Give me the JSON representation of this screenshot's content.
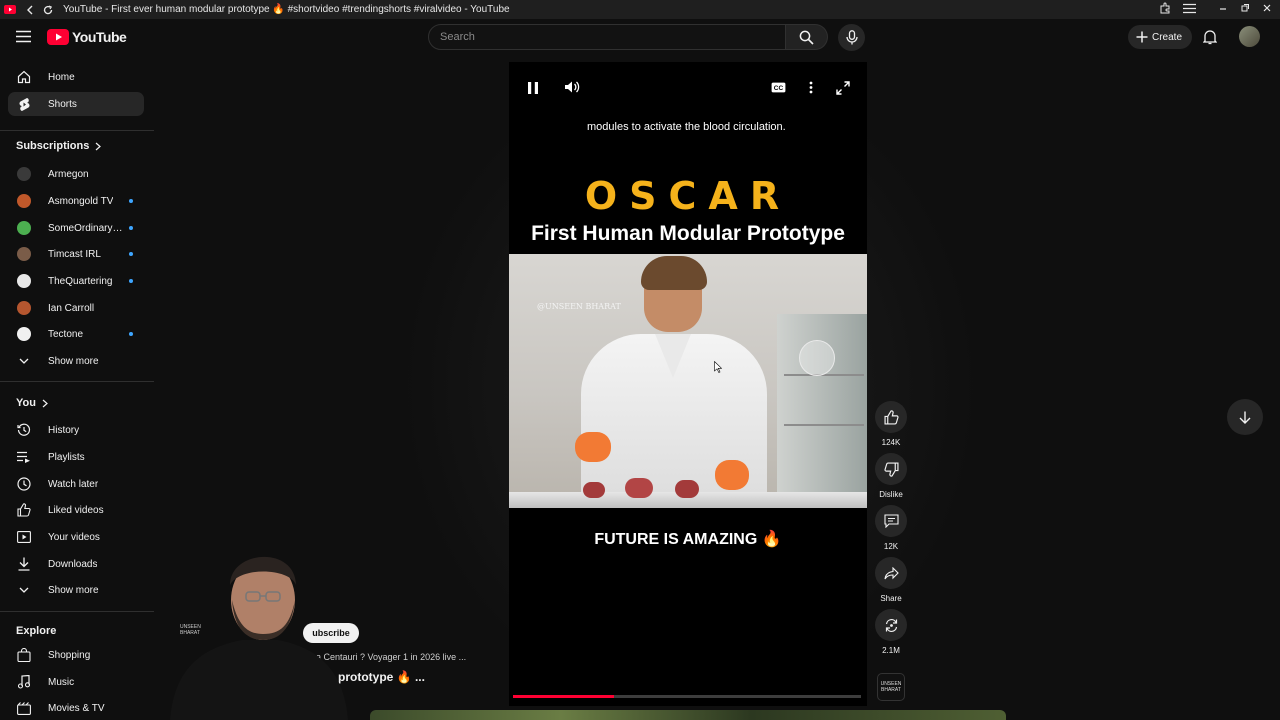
{
  "window": {
    "title": "YouTube - First ever human modular prototype 🔥 #shortvideo #trendingshorts #viralvideo - YouTube"
  },
  "masthead": {
    "logo_text": "YouTube",
    "search_placeholder": "Search",
    "create_label": "Create"
  },
  "sidebar": {
    "main": [
      {
        "label": "Home",
        "icon": "home-icon"
      },
      {
        "label": "Shorts",
        "icon": "shorts-icon",
        "active": true
      }
    ],
    "subscriptions_title": "Subscriptions",
    "subscriptions": [
      {
        "label": "Armegon",
        "color": "#5a4a3a",
        "dot": false
      },
      {
        "label": "Asmongold TV",
        "color": "#c0582a",
        "dot": true
      },
      {
        "label": "SomeOrdinaryGa...",
        "color": "#4caf50",
        "dot": true
      },
      {
        "label": "Timcast IRL",
        "color": "#7a5c48",
        "dot": true
      },
      {
        "label": "TheQuartering",
        "color": "#e8e8e8",
        "dot": true
      },
      {
        "label": "Ian Carroll",
        "color": "#b5562f",
        "dot": false
      },
      {
        "label": "Tectone",
        "color": "#f0f0f0",
        "dot": true
      }
    ],
    "show_more_1": "Show more",
    "you_title": "You",
    "you": [
      {
        "label": "History",
        "icon": "history-icon"
      },
      {
        "label": "Playlists",
        "icon": "playlists-icon"
      },
      {
        "label": "Watch later",
        "icon": "watch-later-icon"
      },
      {
        "label": "Liked videos",
        "icon": "liked-videos-icon"
      },
      {
        "label": "Your videos",
        "icon": "your-videos-icon"
      },
      {
        "label": "Downloads",
        "icon": "downloads-icon"
      }
    ],
    "show_more_2": "Show more",
    "explore_title": "Explore",
    "explore": [
      {
        "label": "Shopping",
        "icon": "shopping-icon"
      },
      {
        "label": "Music",
        "icon": "music-icon"
      },
      {
        "label": "Movies & TV",
        "icon": "movies-icon"
      }
    ]
  },
  "player": {
    "caption": "modules to activate the blood circulation.",
    "headline": "OSCAR",
    "subheadline": "First Human Modular Prototype",
    "watermark": "@UNSEEN BHARAT",
    "bottom_text": "FUTURE IS AMAZING 🔥",
    "progress": 0.29
  },
  "actions": {
    "like_count": "124K",
    "dislike_label": "Dislike",
    "comment_count": "12K",
    "share_label": "Share",
    "remix_count": "2.1M",
    "channel_thumb_text": "UNSEEN BHARAT"
  },
  "overlay": {
    "subscribe_label": "ubscribe",
    "channel_mini": "UNSEEN BHARAT",
    "next_meta": "a Centauri ? Voyager 1 in 2026 live ...",
    "next_title": "prototype 🔥 ..."
  },
  "colors": {
    "accent_red": "#ff0033",
    "oscar_gold": "#f5b21b",
    "notify_blue": "#3ea6ff"
  }
}
